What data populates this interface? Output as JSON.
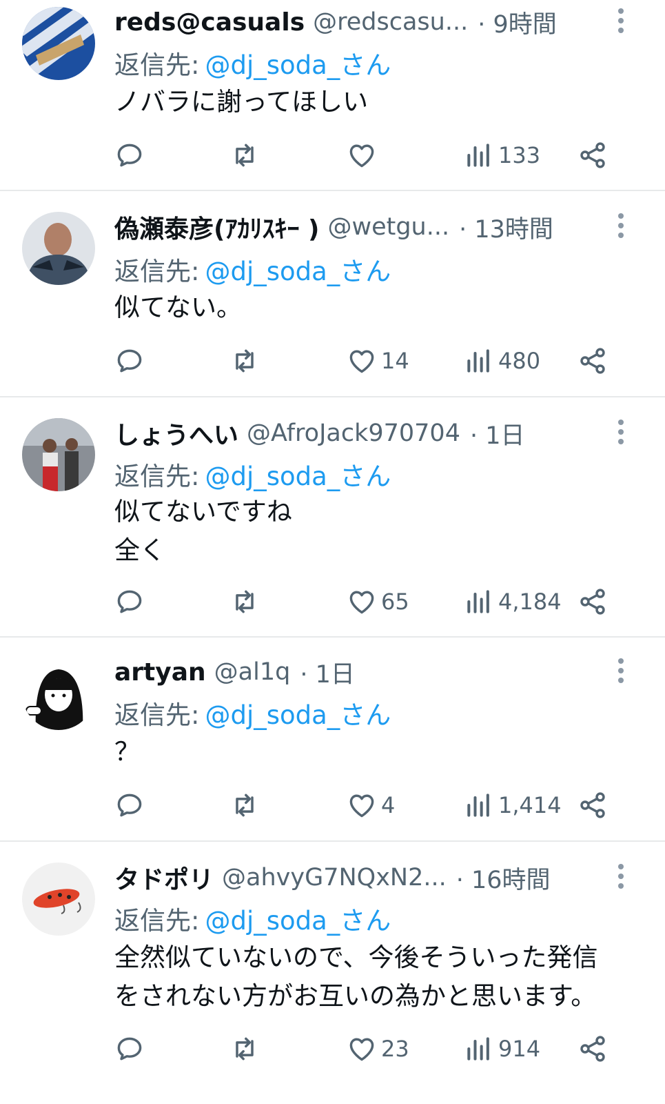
{
  "reply_prefix": "返信先:",
  "colors": {
    "accent": "#1d9bf0",
    "muted": "#536471",
    "text": "#0f1419",
    "divider": "#e7e9ea"
  },
  "icons": [
    "reply-icon",
    "retweet-icon",
    "like-icon",
    "views-icon",
    "share-icon",
    "more-icon"
  ],
  "tweets": [
    {
      "name": "reds@casuals",
      "handle": "@redscasu...",
      "time": "· 9時間",
      "reply_to": "@dj_soda_さん",
      "text": "ノバラに謝ってほしい",
      "likes": "",
      "views": "133"
    },
    {
      "name": "偽瀬泰彦(ｱｶﾘｽｷｰ )",
      "handle": "@wetgu...",
      "time": "· 13時間",
      "reply_to": "@dj_soda_さん",
      "text": "似てない。",
      "likes": "14",
      "views": "480"
    },
    {
      "name": "しょうへい",
      "handle": "@AfroJack970704",
      "time": "· 1日",
      "reply_to": "@dj_soda_さん",
      "text": "似てないですね\n全く",
      "likes": "65",
      "views": "4,184"
    },
    {
      "name": "artyan",
      "handle": "@al1q",
      "time": "· 1日",
      "reply_to": "@dj_soda_さん",
      "text": "？",
      "likes": "4",
      "views": "1,414"
    },
    {
      "name": "タドポリ",
      "handle": "@ahvyG7NQxN2...",
      "time": "· 16時間",
      "reply_to": "@dj_soda_さん",
      "text": "全然似ていないので、今後そういった発信\nをされない方がお互いの為かと思います。",
      "likes": "23",
      "views": "914"
    }
  ]
}
